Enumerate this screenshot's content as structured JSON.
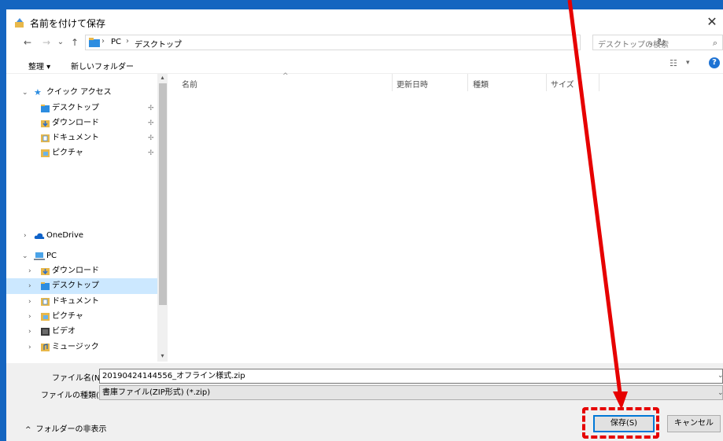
{
  "window": {
    "title": "名前を付けて保存",
    "close_glyph": "✕"
  },
  "nav": {
    "back_glyph": "←",
    "forward_glyph": "→",
    "recent_glyph": "⌄",
    "up_glyph": "↑",
    "breadcrumb": [
      "PC",
      "デスクトップ"
    ],
    "crumb_sep": "›",
    "dropdown_glyph": "⌄",
    "refresh_glyph": "↻",
    "search_placeholder": "デスクトップの検索",
    "search_glyph": "⌕"
  },
  "toolbar": {
    "organize_label": "整理 ▾",
    "new_folder_label": "新しいフォルダー",
    "view_glyph": "☷",
    "view_drop_glyph": "▾",
    "help_glyph": "?"
  },
  "sidebar": {
    "quick_access": "クイック アクセス",
    "quick_items": [
      "デスクトップ",
      "ダウンロード",
      "ドキュメント",
      "ピクチャ"
    ],
    "pin_glyph": "✢",
    "onedrive": "OneDrive",
    "pc": "PC",
    "pc_items": [
      "ダウンロード",
      "デスクトップ",
      "ドキュメント",
      "ピクチャ",
      "ビデオ",
      "ミュージック"
    ],
    "expand_glyph": "›",
    "collapse_glyph": "⌄",
    "scroll_up_glyph": "▴",
    "scroll_down_glyph": "▾"
  },
  "file_list": {
    "sort_glyph": "^",
    "columns": [
      "名前",
      "更新日時",
      "種類",
      "サイズ"
    ]
  },
  "form": {
    "filename_label": "ファイル名(N):",
    "filename_value": "20190424144556_オフライン様式.zip",
    "filetype_label": "ファイルの種類(T):",
    "filetype_value": "書庫ファイル(ZIP形式) (*.zip)",
    "drop_glyph": "⌄"
  },
  "footer": {
    "hide_folders_glyph": "^",
    "hide_folders_label": "フォルダーの非表示",
    "save_label": "保存(S)",
    "cancel_label": "キャンセル"
  },
  "colors": {
    "annotation_red": "#e60000",
    "selection": "#cce8ff",
    "accent": "#0078d7"
  }
}
